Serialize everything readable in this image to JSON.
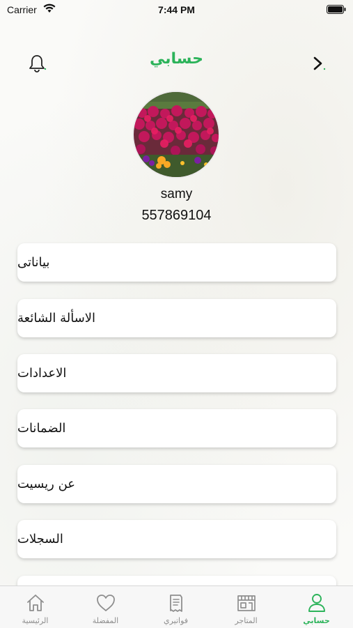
{
  "status_bar": {
    "carrier": "Carrier",
    "time": "7:44 PM"
  },
  "header": {
    "title": "حسابي"
  },
  "profile": {
    "name": "samy",
    "phone": "557869104"
  },
  "menu": {
    "items": [
      {
        "label": "بياناتى"
      },
      {
        "label": "الاسألة الشائعة"
      },
      {
        "label": "الاعدادات"
      },
      {
        "label": "الضمانات"
      },
      {
        "label": "عن ريسيت"
      },
      {
        "label": "السجلات"
      }
    ]
  },
  "tabbar": {
    "tabs": [
      {
        "label": "الرئيسية",
        "icon": "home-icon"
      },
      {
        "label": "المفضلة",
        "icon": "heart-icon"
      },
      {
        "label": "فواتيري",
        "icon": "receipt-icon"
      },
      {
        "label": "المتاجر",
        "icon": "store-icon"
      },
      {
        "label": "حسابي",
        "icon": "user-icon",
        "active": true
      }
    ]
  },
  "colors": {
    "accent": "#2cb35a",
    "inactive": "#8e8e8e"
  }
}
